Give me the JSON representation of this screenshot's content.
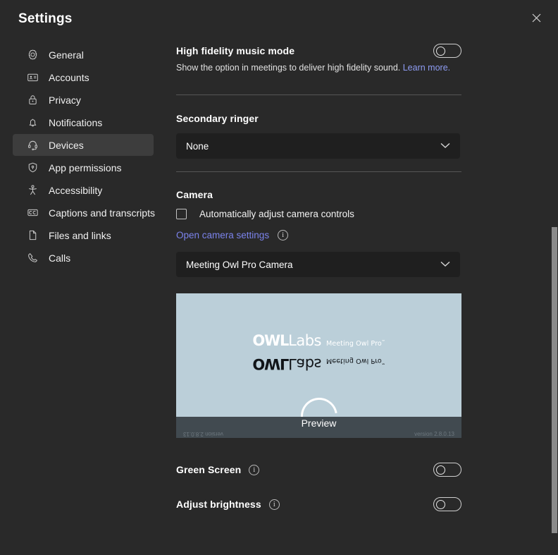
{
  "window": {
    "title": "Settings",
    "close_icon": "close-icon"
  },
  "sidebar": {
    "items": [
      {
        "label": "General",
        "icon": "gear-icon",
        "active": false
      },
      {
        "label": "Accounts",
        "icon": "id-card-icon",
        "active": false
      },
      {
        "label": "Privacy",
        "icon": "lock-icon",
        "active": false
      },
      {
        "label": "Notifications",
        "icon": "bell-icon",
        "active": false
      },
      {
        "label": "Devices",
        "icon": "headset-icon",
        "active": true
      },
      {
        "label": "App permissions",
        "icon": "shield-icon",
        "active": false
      },
      {
        "label": "Accessibility",
        "icon": "accessibility-person-icon",
        "active": false
      },
      {
        "label": "Captions and transcripts",
        "icon": "closed-caption-icon",
        "active": false
      },
      {
        "label": "Files and links",
        "icon": "file-icon",
        "active": false
      },
      {
        "label": "Calls",
        "icon": "phone-icon",
        "active": false
      }
    ]
  },
  "main": {
    "high_fidelity": {
      "title": "High fidelity music mode",
      "description": "Show the option in meetings to deliver high fidelity sound.",
      "link": "Learn more.",
      "toggle_state": "off"
    },
    "secondary_ringer": {
      "title": "Secondary ringer",
      "selected": "None"
    },
    "camera": {
      "title": "Camera",
      "auto_adjust_label": "Automatically adjust camera controls",
      "auto_adjust_checked": "false",
      "open_settings_link": "Open camera settings",
      "info_icon_glyph": "i",
      "selected_camera": "Meeting Owl Pro Camera"
    },
    "preview": {
      "label": "Preview",
      "logo_owl": "OWL",
      "logo_labs": "Labs",
      "logo_sub": "Meeting Owl Pro˜",
      "version_left": "version 2.8.0.13",
      "version_right": "version 2.8.0.13"
    },
    "green_screen": {
      "title": "Green Screen",
      "info_icon_glyph": "i",
      "toggle_state": "off"
    },
    "adjust_brightness": {
      "title": "Adjust brightness",
      "info_icon_glyph": "i",
      "toggle_state": "off"
    }
  },
  "colors": {
    "background": "#292929",
    "sidebar_active": "#3d3d3d",
    "dropdown": "#1f1f1f",
    "link": "#7b83eb",
    "preview_bg": "#bbcfd9",
    "preview_bar": "#414a50",
    "scrollbar": "#8a8a8a"
  }
}
